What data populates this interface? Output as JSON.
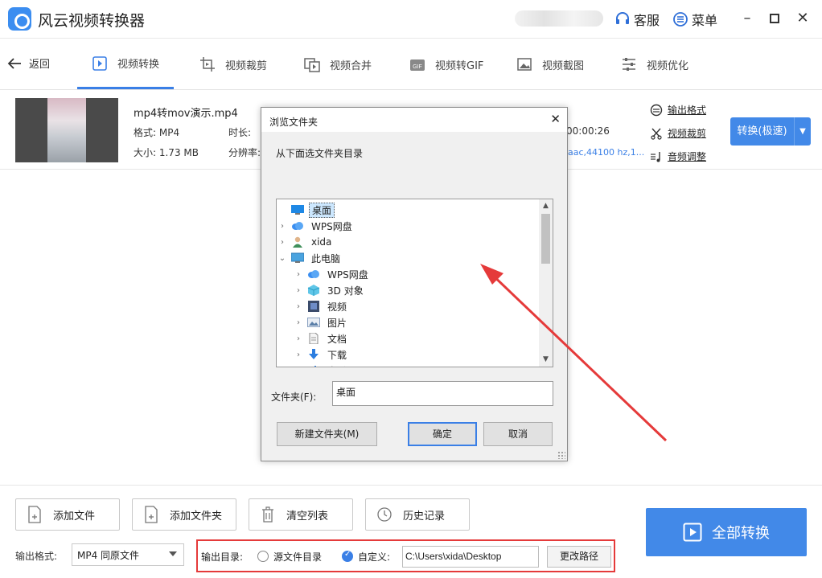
{
  "app": {
    "title": "风云视频转换器",
    "service_label": "客服",
    "menu_label": "菜单"
  },
  "nav": {
    "back_label": "返回",
    "tabs": [
      {
        "label": "视频转换",
        "icon": "video-convert-icon",
        "active": true
      },
      {
        "label": "视频裁剪",
        "icon": "video-crop-icon",
        "active": false
      },
      {
        "label": "视频合并",
        "icon": "video-merge-icon",
        "active": false
      },
      {
        "label": "视频转GIF",
        "icon": "gif-icon",
        "active": false
      },
      {
        "label": "视频截图",
        "icon": "screenshot-icon",
        "active": false
      },
      {
        "label": "视频优化",
        "icon": "optimize-icon",
        "active": false
      }
    ]
  },
  "file": {
    "name": "mp4转mov演示.mp4",
    "format": "格式: MP4",
    "size": "大小: 1.73 MB",
    "duration_label": "时长:",
    "resolution_label": "分辨率:",
    "duration_tail": "00:00:26",
    "audio_tail": "aac,44100 hz,1...",
    "options": {
      "output_format": "输出格式",
      "video_crop": "视频裁剪",
      "audio_adjust": "音频调整"
    },
    "convert_button": "转换(极速)"
  },
  "dialog": {
    "title": "浏览文件夹",
    "instruction": "从下面选文件夹目录",
    "tree": [
      {
        "label": "桌面",
        "icon": "desktop-icon",
        "level": 0,
        "expander": "",
        "selected": true
      },
      {
        "label": "WPS网盘",
        "icon": "cloud-icon",
        "level": 0,
        "expander": "›",
        "selected": false
      },
      {
        "label": "xida",
        "icon": "user-icon",
        "level": 0,
        "expander": "›",
        "selected": false
      },
      {
        "label": "此电脑",
        "icon": "computer-icon",
        "level": 0,
        "expander": "⌄",
        "selected": false
      },
      {
        "label": "WPS网盘",
        "icon": "cloud-icon",
        "level": 1,
        "expander": "›",
        "selected": false
      },
      {
        "label": "3D 对象",
        "icon": "cube-icon",
        "level": 1,
        "expander": "›",
        "selected": false
      },
      {
        "label": "视频",
        "icon": "film-icon",
        "level": 1,
        "expander": "›",
        "selected": false
      },
      {
        "label": "图片",
        "icon": "picture-icon",
        "level": 1,
        "expander": "›",
        "selected": false
      },
      {
        "label": "文档",
        "icon": "document-icon",
        "level": 1,
        "expander": "›",
        "selected": false
      },
      {
        "label": "下载",
        "icon": "download-icon",
        "level": 1,
        "expander": "›",
        "selected": false
      },
      {
        "label": "音乐",
        "icon": "music-icon",
        "level": 1,
        "expander": "›",
        "selected": false
      }
    ],
    "folder_label": "文件夹(F):",
    "folder_value": "桌面",
    "new_folder_button": "新建文件夹(M)",
    "ok_button": "确定",
    "cancel_button": "取消"
  },
  "bottom": {
    "actions": [
      {
        "label": "添加文件",
        "icon": "add-file-icon"
      },
      {
        "label": "添加文件夹",
        "icon": "add-folder-icon"
      },
      {
        "label": "清空列表",
        "icon": "trash-icon"
      },
      {
        "label": "历史记录",
        "icon": "history-icon"
      }
    ],
    "convert_all": "全部转换",
    "format_label": "输出格式:",
    "format_value": "MP4 同原文件",
    "output_dir_label": "输出目录:",
    "source_folder_label": "源文件目录",
    "custom_label": "自定义:",
    "custom_path": "C:\\Users\\xida\\Desktop",
    "change_path_button": "更改路径"
  },
  "colors": {
    "accent": "#4289e8",
    "highlight_box": "#e53a3a",
    "annotation_arrow": "#e53a3a"
  }
}
